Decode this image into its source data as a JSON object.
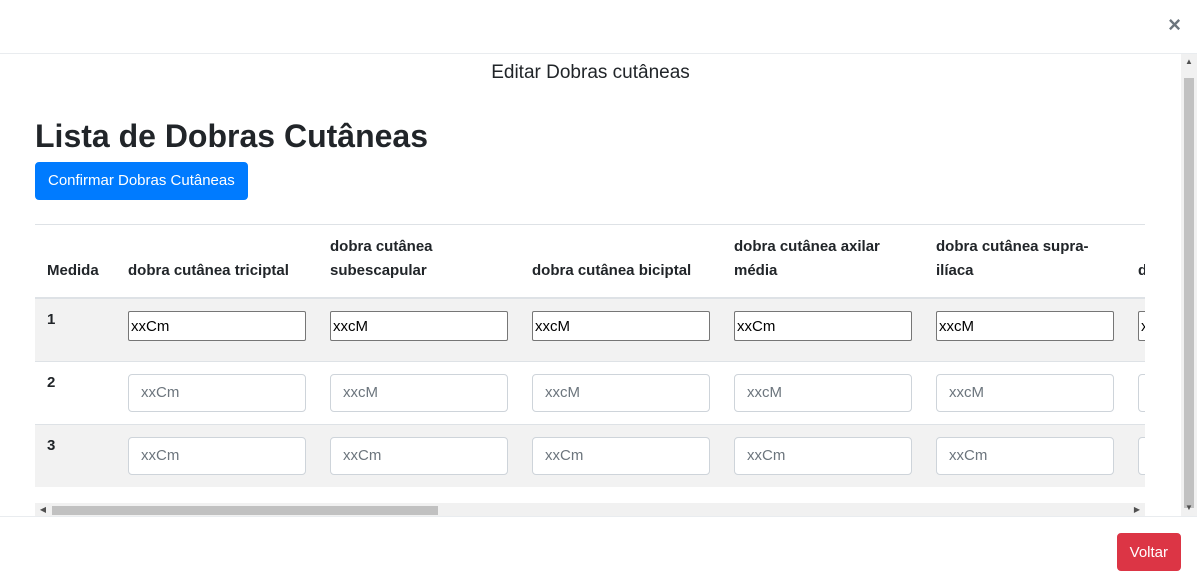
{
  "modal": {
    "close_symbol": "×",
    "subtitle": "Editar Dobras cutâneas"
  },
  "page": {
    "title": "Lista de Dobras Cutâneas",
    "confirm_button": "Confirmar Dobras Cutâneas"
  },
  "table": {
    "headers": [
      "Medida",
      "dobra cutânea triciptal",
      "dobra cutânea subescapular",
      "dobra cutânea biciptal",
      "dobra cutânea axilar média",
      "dobra cutânea supra-ilíaca",
      "d"
    ],
    "rows": [
      {
        "label": "1",
        "values": [
          "xxCm",
          "xxcM",
          "xxcM",
          "xxCm",
          "xxcM",
          "x"
        ]
      },
      {
        "label": "2",
        "placeholders": [
          "xxCm",
          "xxcM",
          "xxcM",
          "xxcM",
          "xxcM",
          ""
        ]
      },
      {
        "label": "3",
        "placeholders": [
          "xxCm",
          "xxCm",
          "xxCm",
          "xxCm",
          "xxCm",
          ""
        ]
      }
    ]
  },
  "footer": {
    "back_button": "Voltar"
  },
  "colors": {
    "primary": "#007bff",
    "danger": "#dc3545",
    "row_stripe": "#f2f2f2"
  },
  "icons": {
    "close": "close-icon",
    "scroll_up": "arrow-up-icon",
    "scroll_down": "arrow-down-icon",
    "scroll_left": "arrow-left-icon",
    "scroll_right": "arrow-right-icon"
  }
}
